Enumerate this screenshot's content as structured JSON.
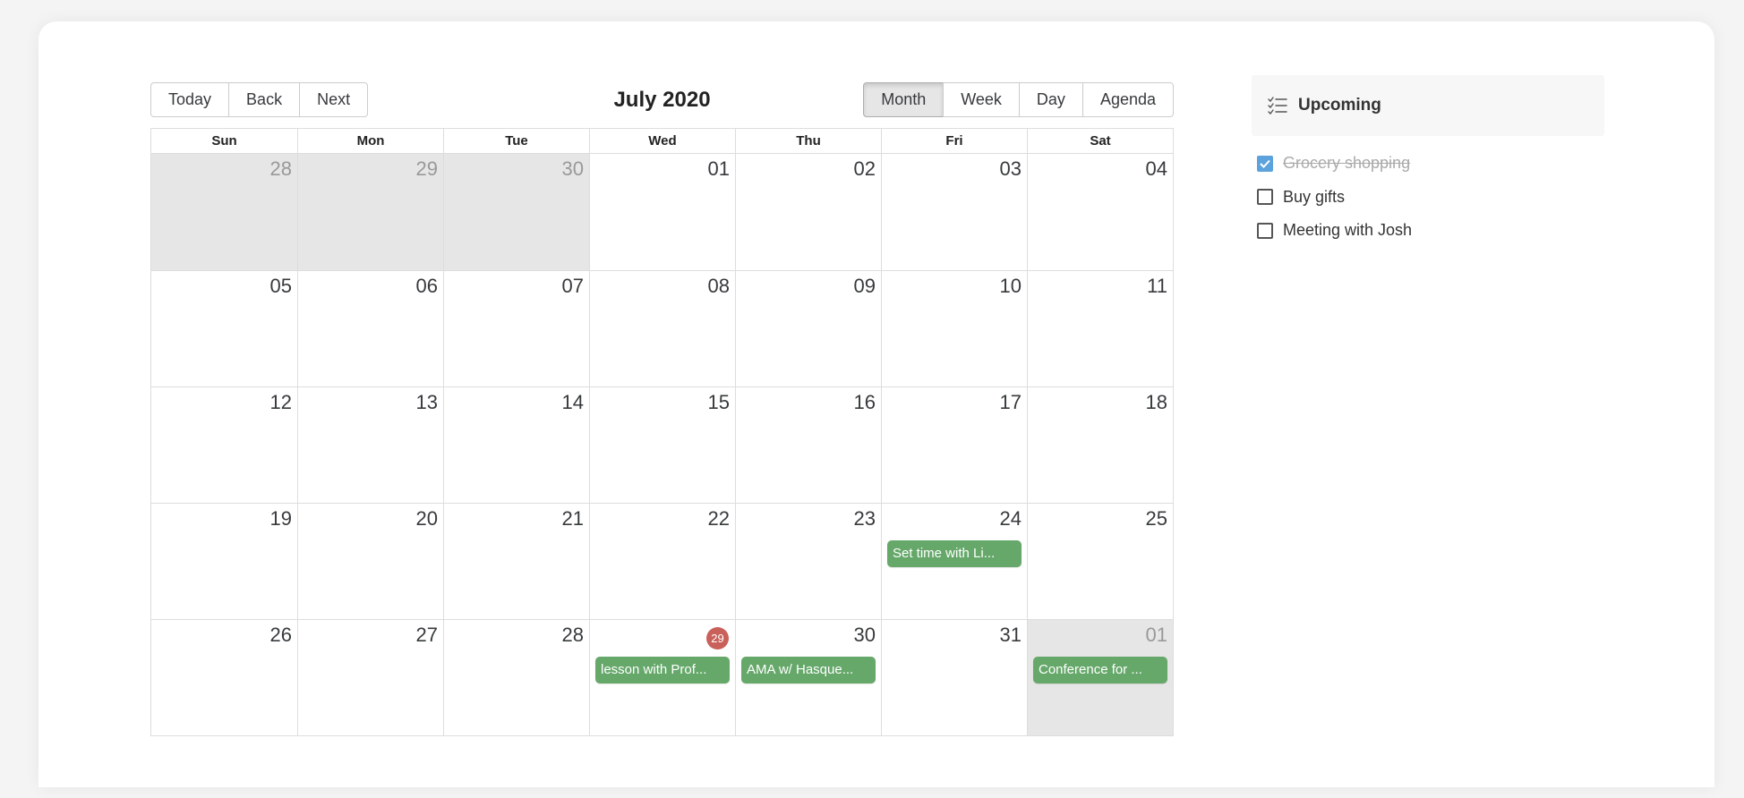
{
  "toolbar": {
    "nav_buttons": [
      "Today",
      "Back",
      "Next"
    ],
    "label": "July 2020",
    "view_buttons": [
      "Month",
      "Week",
      "Day",
      "Agenda"
    ],
    "active_view": "Month"
  },
  "weekdays": [
    "Sun",
    "Mon",
    "Tue",
    "Wed",
    "Thu",
    "Fri",
    "Sat"
  ],
  "weeks": [
    [
      {
        "date": "28",
        "off_range": true
      },
      {
        "date": "29",
        "off_range": true
      },
      {
        "date": "30",
        "off_range": true
      },
      {
        "date": "01"
      },
      {
        "date": "02"
      },
      {
        "date": "03"
      },
      {
        "date": "04"
      }
    ],
    [
      {
        "date": "05"
      },
      {
        "date": "06"
      },
      {
        "date": "07"
      },
      {
        "date": "08"
      },
      {
        "date": "09"
      },
      {
        "date": "10"
      },
      {
        "date": "11"
      }
    ],
    [
      {
        "date": "12"
      },
      {
        "date": "13"
      },
      {
        "date": "14"
      },
      {
        "date": "15"
      },
      {
        "date": "16"
      },
      {
        "date": "17"
      },
      {
        "date": "18"
      }
    ],
    [
      {
        "date": "19"
      },
      {
        "date": "20"
      },
      {
        "date": "21"
      },
      {
        "date": "22"
      },
      {
        "date": "23"
      },
      {
        "date": "24",
        "event": "Set time with Li..."
      },
      {
        "date": "25"
      }
    ],
    [
      {
        "date": "26"
      },
      {
        "date": "27"
      },
      {
        "date": "28"
      },
      {
        "date": "29",
        "today": true,
        "event": "lesson with Prof..."
      },
      {
        "date": "30",
        "event": "AMA w/ Hasque..."
      },
      {
        "date": "31"
      },
      {
        "date": "01",
        "off_range": true,
        "event": "Conference for ..."
      }
    ]
  ],
  "colors": {
    "event": "#65a86a",
    "today_badge": "#c9615a",
    "checkbox_checked": "#5ca2dc",
    "off_range_bg": "#e6e6e6"
  },
  "upcoming": {
    "title": "Upcoming",
    "icon": "checklist-icon",
    "items": [
      {
        "label": "Grocery shopping",
        "done": true
      },
      {
        "label": "Buy gifts",
        "done": false
      },
      {
        "label": "Meeting with Josh",
        "done": false
      }
    ]
  }
}
